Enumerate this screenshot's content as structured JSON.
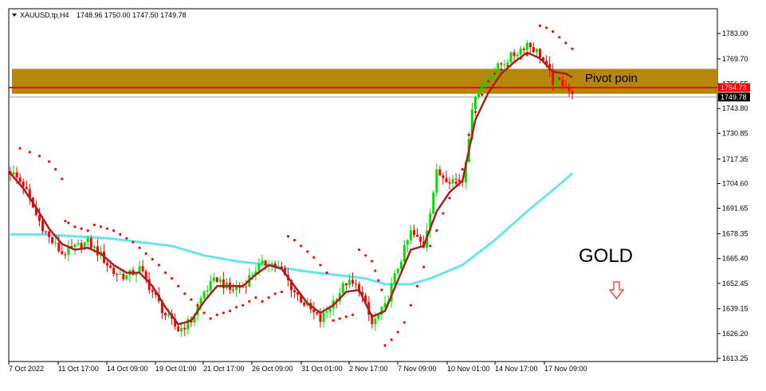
{
  "header": {
    "symbol": "XAUUSD,tp,H4",
    "ohlc": "1748.96 1750.00 1747.50 1749.78"
  },
  "annotations": {
    "pivot_label": "Pivot poin",
    "gold_label": "GOLD",
    "down_arrow_icon": "down-arrow-outline-icon"
  },
  "price_tags": {
    "pivot_price": "1754.73",
    "current_price": "1749.78"
  },
  "colors": {
    "bull": "#00e000",
    "bear": "#ff0000",
    "ma_slow": "#66e4f4",
    "ma_fast": "#a52020",
    "sar": "#ff0000",
    "pivot_zone": "#b8860b",
    "pivot_line": "#ff0000",
    "current_tag": "#000000",
    "pivot_tag": "#ff0000"
  },
  "chart_data": {
    "type": "candlestick",
    "ylim": [
      1613.25,
      1789.0
    ],
    "y_ticks": [
      "1783.00",
      "1769.70",
      "1756.55",
      "1743.80",
      "1730.85",
      "1717.35",
      "1704.60",
      "1691.65",
      "1678.35",
      "1665.40",
      "1652.45",
      "1639.15",
      "1626.20",
      "1613.25"
    ],
    "x_ticks": [
      "7 Oct 2022",
      "11 Oct 17:00",
      "14 Oct 09:00",
      "19 Oct 01:00",
      "21 Oct 17:00",
      "26 Oct 09:00",
      "31 Oct 01:00",
      "2 Nov 17:00",
      "7 Nov 09:00",
      "10 Nov 01:00",
      "14 Nov 17:00",
      "17 Nov 09:00"
    ],
    "pivot_zone": [
      1751.5,
      1764.5
    ],
    "pivot_line": 1754.73,
    "current_price": 1749.78,
    "close_path": [
      [
        0,
        1711
      ],
      [
        4,
        1704
      ],
      [
        8,
        1688
      ],
      [
        12,
        1676
      ],
      [
        16,
        1668
      ],
      [
        20,
        1671
      ],
      [
        24,
        1674
      ],
      [
        28,
        1667
      ],
      [
        32,
        1658
      ],
      [
        36,
        1656
      ],
      [
        40,
        1660
      ],
      [
        44,
        1648
      ],
      [
        48,
        1636
      ],
      [
        52,
        1628
      ],
      [
        56,
        1633
      ],
      [
        60,
        1648
      ],
      [
        64,
        1655
      ],
      [
        68,
        1649
      ],
      [
        72,
        1651
      ],
      [
        76,
        1660
      ],
      [
        80,
        1664
      ],
      [
        84,
        1659
      ],
      [
        88,
        1648
      ],
      [
        92,
        1640
      ],
      [
        96,
        1633
      ],
      [
        100,
        1643
      ],
      [
        104,
        1653
      ],
      [
        108,
        1650
      ],
      [
        112,
        1631
      ],
      [
        116,
        1640
      ],
      [
        120,
        1661
      ],
      [
        124,
        1679
      ],
      [
        128,
        1672
      ],
      [
        132,
        1710
      ],
      [
        136,
        1707
      ],
      [
        140,
        1706
      ],
      [
        142,
        1730
      ],
      [
        144,
        1752
      ],
      [
        148,
        1760
      ],
      [
        152,
        1767
      ],
      [
        156,
        1772
      ],
      [
        160,
        1778
      ],
      [
        164,
        1772
      ],
      [
        168,
        1758
      ],
      [
        172,
        1757
      ],
      [
        174,
        1749.78
      ]
    ],
    "ma_fast": [
      [
        0,
        1710
      ],
      [
        4,
        1702
      ],
      [
        8,
        1692
      ],
      [
        12,
        1681
      ],
      [
        16,
        1673
      ],
      [
        20,
        1670
      ],
      [
        24,
        1671
      ],
      [
        28,
        1668
      ],
      [
        32,
        1662
      ],
      [
        36,
        1658
      ],
      [
        40,
        1658
      ],
      [
        44,
        1651
      ],
      [
        48,
        1640
      ],
      [
        52,
        1631
      ],
      [
        56,
        1633
      ],
      [
        60,
        1643
      ],
      [
        64,
        1651
      ],
      [
        68,
        1651
      ],
      [
        72,
        1651
      ],
      [
        76,
        1657
      ],
      [
        80,
        1662
      ],
      [
        84,
        1660
      ],
      [
        88,
        1651
      ],
      [
        92,
        1642
      ],
      [
        96,
        1637
      ],
      [
        100,
        1641
      ],
      [
        104,
        1648
      ],
      [
        108,
        1649
      ],
      [
        112,
        1635
      ],
      [
        116,
        1638
      ],
      [
        120,
        1654
      ],
      [
        124,
        1670
      ],
      [
        128,
        1672
      ],
      [
        132,
        1690
      ],
      [
        136,
        1700
      ],
      [
        140,
        1706
      ],
      [
        144,
        1738
      ],
      [
        148,
        1752
      ],
      [
        152,
        1762
      ],
      [
        156,
        1768
      ],
      [
        160,
        1773
      ],
      [
        164,
        1770
      ],
      [
        168,
        1763
      ],
      [
        172,
        1762
      ],
      [
        174,
        1760
      ]
    ],
    "ma_slow": [
      [
        0,
        1678
      ],
      [
        10,
        1678
      ],
      [
        20,
        1677
      ],
      [
        30,
        1676
      ],
      [
        40,
        1674
      ],
      [
        50,
        1672
      ],
      [
        60,
        1667
      ],
      [
        70,
        1664
      ],
      [
        80,
        1662
      ],
      [
        90,
        1659
      ],
      [
        100,
        1657
      ],
      [
        110,
        1655
      ],
      [
        116,
        1652
      ],
      [
        124,
        1652
      ],
      [
        130,
        1655
      ],
      [
        140,
        1662
      ],
      [
        150,
        1675
      ],
      [
        160,
        1690
      ],
      [
        170,
        1704
      ],
      [
        174,
        1710
      ]
    ],
    "sar": [
      [
        3,
        1723
      ],
      [
        6,
        1721
      ],
      [
        9,
        1719
      ],
      [
        12,
        1716
      ],
      [
        14,
        1712
      ],
      [
        16,
        1707
      ],
      [
        17,
        1685
      ],
      [
        18,
        1684
      ],
      [
        20,
        1682
      ],
      [
        22,
        1681
      ],
      [
        24,
        1680
      ],
      [
        26,
        1683
      ],
      [
        28,
        1682
      ],
      [
        30,
        1681
      ],
      [
        32,
        1680
      ],
      [
        34,
        1678
      ],
      [
        36,
        1676
      ],
      [
        38,
        1674
      ],
      [
        40,
        1671
      ],
      [
        42,
        1668
      ],
      [
        44,
        1665
      ],
      [
        46,
        1662
      ],
      [
        48,
        1658
      ],
      [
        50,
        1655
      ],
      [
        52,
        1651
      ],
      [
        54,
        1647
      ],
      [
        56,
        1644
      ],
      [
        58,
        1641
      ],
      [
        60,
        1637
      ],
      [
        62,
        1634
      ],
      [
        64,
        1636
      ],
      [
        66,
        1637
      ],
      [
        68,
        1638
      ],
      [
        70,
        1640
      ],
      [
        72,
        1641
      ],
      [
        74,
        1643
      ],
      [
        76,
        1645
      ],
      [
        78,
        1643
      ],
      [
        80,
        1645
      ],
      [
        82,
        1647
      ],
      [
        84,
        1648
      ],
      [
        86,
        1677
      ],
      [
        88,
        1675
      ],
      [
        90,
        1672
      ],
      [
        92,
        1669
      ],
      [
        94,
        1666
      ],
      [
        96,
        1662
      ],
      [
        98,
        1658
      ],
      [
        100,
        1633
      ],
      [
        102,
        1634
      ],
      [
        104,
        1635
      ],
      [
        106,
        1636
      ],
      [
        108,
        1670
      ],
      [
        110,
        1667
      ],
      [
        112,
        1664
      ],
      [
        113,
        1659
      ],
      [
        114,
        1654
      ],
      [
        115,
        1649
      ],
      [
        116,
        1620
      ],
      [
        118,
        1623
      ],
      [
        120,
        1627
      ],
      [
        122,
        1632
      ],
      [
        124,
        1641
      ],
      [
        126,
        1651
      ],
      [
        128,
        1661
      ],
      [
        130,
        1672
      ],
      [
        132,
        1680
      ],
      [
        134,
        1689
      ],
      [
        136,
        1697
      ],
      [
        138,
        1705
      ],
      [
        140,
        1712
      ],
      [
        142,
        1730
      ],
      [
        144,
        1742
      ],
      [
        146,
        1751
      ],
      [
        148,
        1758
      ],
      [
        150,
        1762
      ],
      [
        152,
        1764
      ],
      [
        154,
        1766
      ],
      [
        156,
        1768
      ],
      [
        158,
        1770
      ],
      [
        160,
        1772
      ],
      [
        162,
        1774
      ],
      [
        164,
        1787
      ],
      [
        166,
        1786
      ],
      [
        168,
        1784
      ],
      [
        170,
        1781
      ],
      [
        172,
        1778
      ],
      [
        174,
        1775
      ]
    ]
  }
}
